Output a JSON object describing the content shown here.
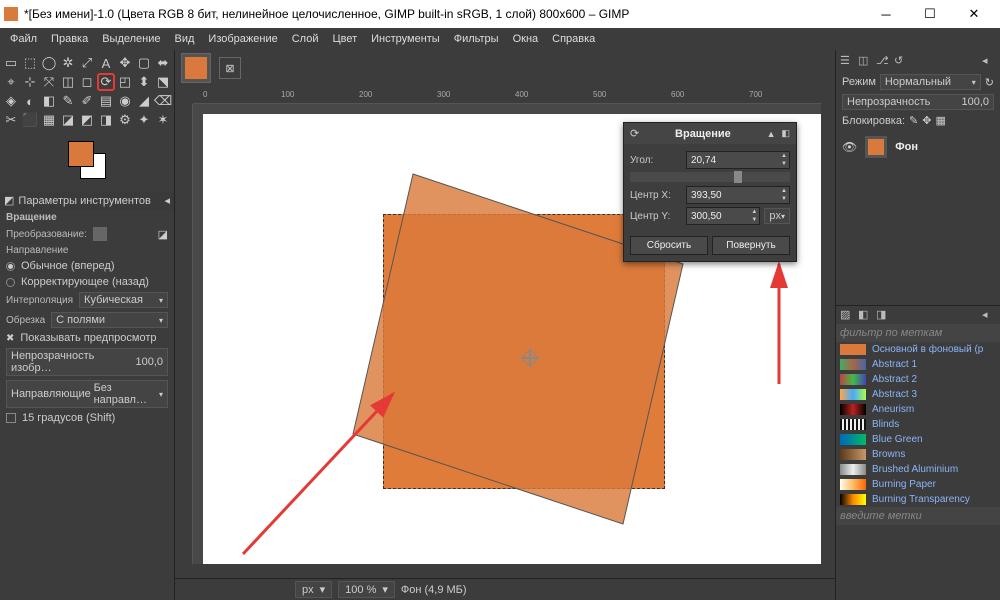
{
  "titlebar": {
    "title": "*[Без имени]-1.0 (Цвета RGB 8 бит, нелинейное целочисленное, GIMP built-in sRGB, 1 слой) 800x600 – GIMP"
  },
  "menubar": [
    "Файл",
    "Правка",
    "Выделение",
    "Вид",
    "Изображение",
    "Слой",
    "Цвет",
    "Инструменты",
    "Фильтры",
    "Окна",
    "Справка"
  ],
  "ruler_ticks": [
    "0",
    "100",
    "200",
    "300",
    "400",
    "500",
    "600",
    "700"
  ],
  "tool_options": {
    "panel_title": "Параметры инструментов",
    "tool_name": "Вращение",
    "transform_label": "Преобразование:",
    "direction_label": "Направление",
    "direction_normal": "Обычное (вперед)",
    "direction_corrective": "Корректирующее (назад)",
    "interpolation_label": "Интерполяция",
    "interpolation_value": "Кубическая",
    "clipping_label": "Обрезка",
    "clipping_value": "С полями",
    "show_preview": "Показывать предпросмотр",
    "image_opacity_label": "Непрозрачность изобр…",
    "image_opacity_value": "100,0",
    "guides_label": "Направляющие",
    "guides_value": "Без направл…",
    "fifteen_degrees": "15 градусов (Shift)"
  },
  "rotate_dialog": {
    "title": "Вращение",
    "angle_label": "Угол:",
    "angle_value": "20,74",
    "center_x_label": "Центр X:",
    "center_x_value": "393,50",
    "center_y_label": "Центр Y:",
    "center_y_value": "300,50",
    "unit": "px",
    "reset": "Сбросить",
    "rotate": "Повернуть"
  },
  "right_panel": {
    "mode_label": "Режим",
    "mode_value": "Нормальный",
    "opacity_label": "Непрозрачность",
    "opacity_value": "100,0",
    "lock_label": "Блокировка:",
    "layer_name": "Фон",
    "filter_placeholder": "фильтр по меткам",
    "tags_placeholder": "введите метки",
    "fg_to_bg": "Основной в фоновый (р"
  },
  "gradients": [
    "Abstract 1",
    "Abstract 2",
    "Abstract 3",
    "Aneurism",
    "Blinds",
    "Blue Green",
    "Browns",
    "Brushed Aluminium",
    "Burning Paper",
    "Burning Transparency"
  ],
  "gradient_colors": [
    "linear-gradient(90deg,#4a6,#a64,#46a)",
    "linear-gradient(90deg,#b44,#4b4,#44b)",
    "linear-gradient(90deg,#fa4,#4af,#af4)",
    "linear-gradient(90deg,#000,#b22,#000)",
    "repeating-linear-gradient(90deg,#111 0 2px,#eee 2px 4px)",
    "linear-gradient(90deg,#06b,#0b6)",
    "linear-gradient(90deg,#5a3a1a,#c89868)",
    "linear-gradient(90deg,#888,#eee,#888)",
    "linear-gradient(90deg,#ffe,#fb6,#f60)",
    "linear-gradient(90deg,#000,#f80,#ff0)"
  ],
  "statusbar": {
    "unit": "px",
    "zoom": "100 %",
    "info": "Фон (4,9 МБ)"
  }
}
